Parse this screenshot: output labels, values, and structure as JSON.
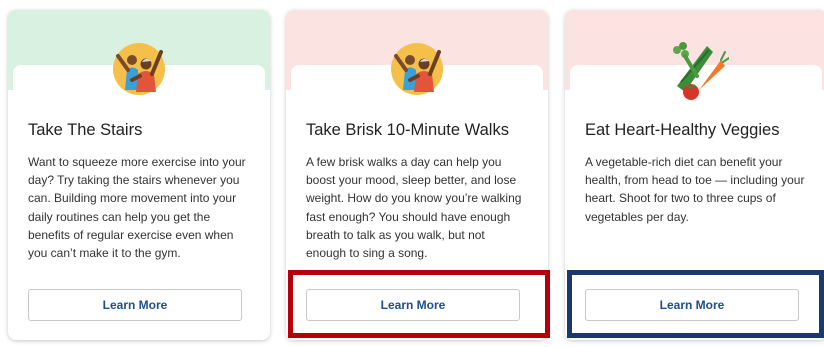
{
  "cards": [
    {
      "title": "Take The Stairs",
      "body": "Want to squeeze more exercise into your day? Try taking the stairs whenever you can. Building more movement into your daily routines can help you get the benefits of regular exercise even when you can’t make it to the gym.",
      "button_label": "Learn More",
      "banner_color": "#d8f1e1",
      "illustration": "exercising-couple-icon"
    },
    {
      "title": "Take Brisk 10-Minute Walks",
      "body": "A few brisk walks a day can help you boost your mood, sleep better, and lose weight. How do you know you’re walking fast enough? You should have enough breath to talk as you walk, but not enough to sing a song.",
      "button_label": "Learn More",
      "banner_color": "#fbe3e1",
      "illustration": "exercising-couple-icon"
    },
    {
      "title": "Eat Heart-Healthy Veggies",
      "body": "A vegetable-rich diet can benefit your health, from head to toe — including your heart. Shoot for two to three cups of vegetables per day.",
      "button_label": "Learn More",
      "banner_color": "#fde2e2",
      "illustration": "vegetables-icon"
    }
  ],
  "highlights": {
    "walks_button_color": "#b5000c",
    "veggies_button_color": "#1a3a6b"
  }
}
